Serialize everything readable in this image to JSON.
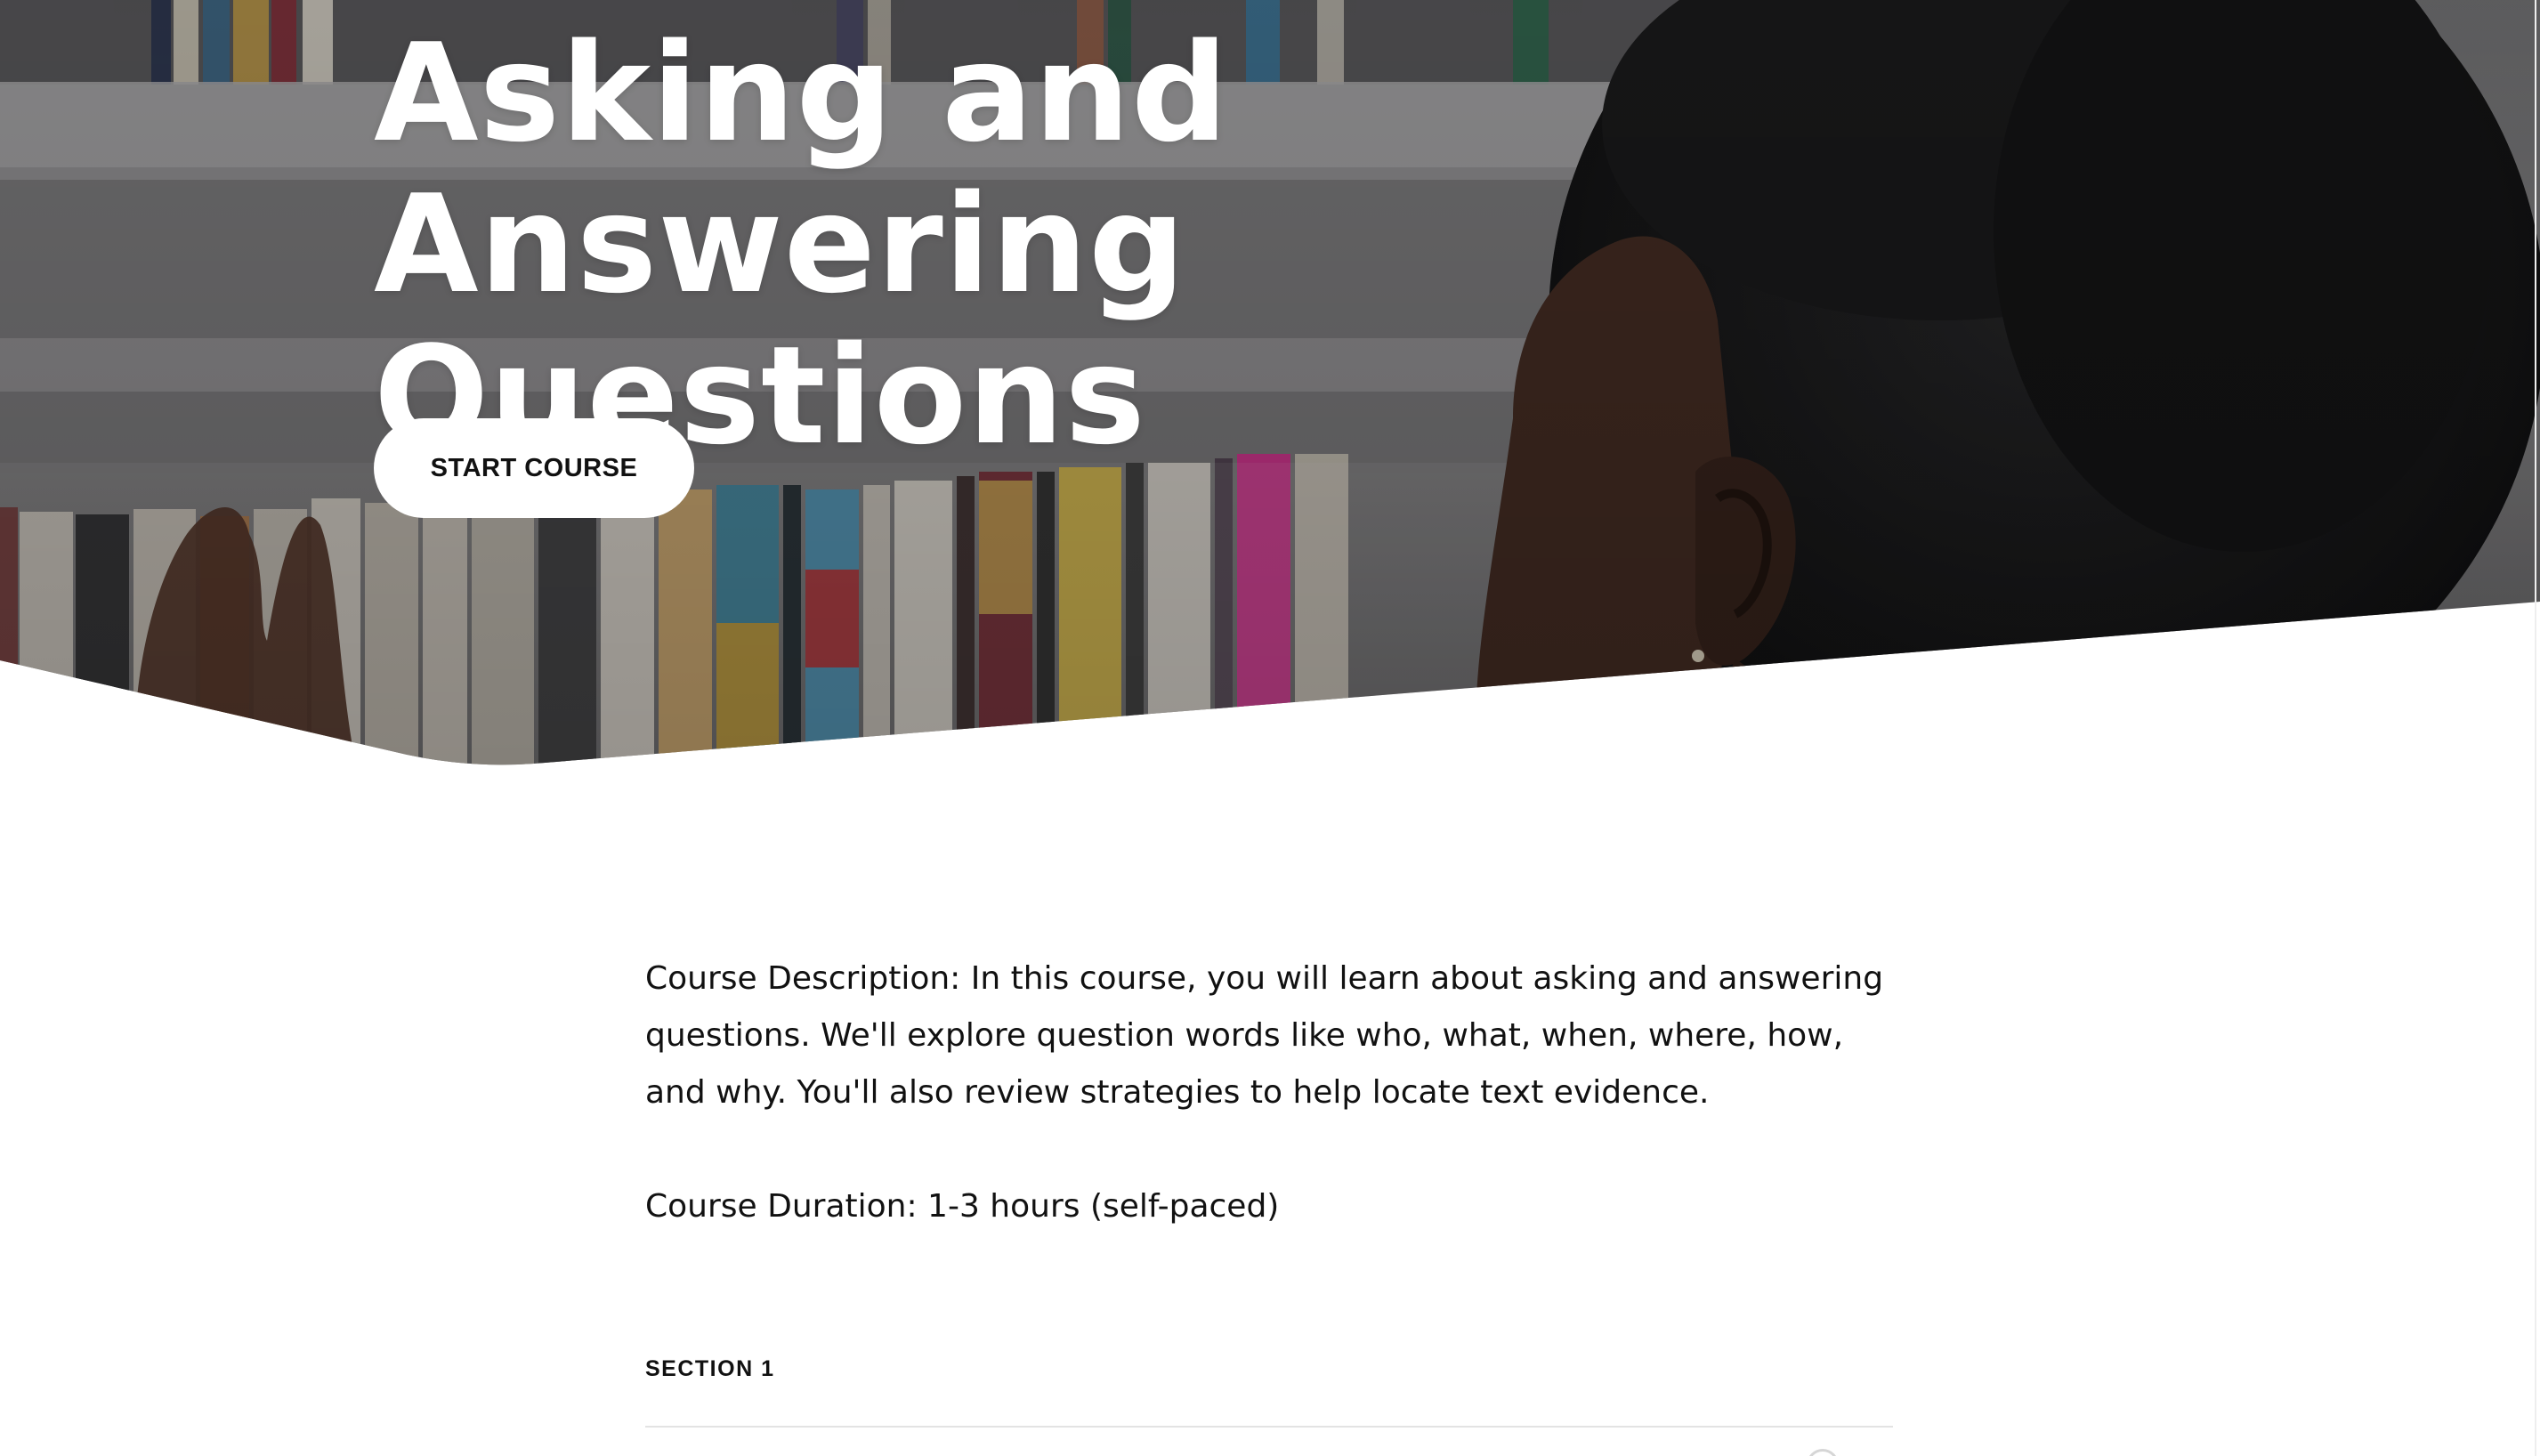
{
  "hero": {
    "title": "Asking and Answering Questions",
    "start_button_label": "START COURSE",
    "photo": "student-browsing-bookshelf-photo"
  },
  "course": {
    "description": "Course Description: In this course, you will learn about asking and answering questions. We'll explore question words like who, what, when, where, how, and why. You'll also review strategies to help locate text evidence.",
    "duration": "Course Duration: 1-3 hours (self-paced)"
  },
  "sections": [
    {
      "label": "SECTION 1"
    }
  ],
  "colors": {
    "hero_text": "#ffffff",
    "button_bg": "#ffffff",
    "body_text": "#111111",
    "divider": "#e3e3e3"
  }
}
